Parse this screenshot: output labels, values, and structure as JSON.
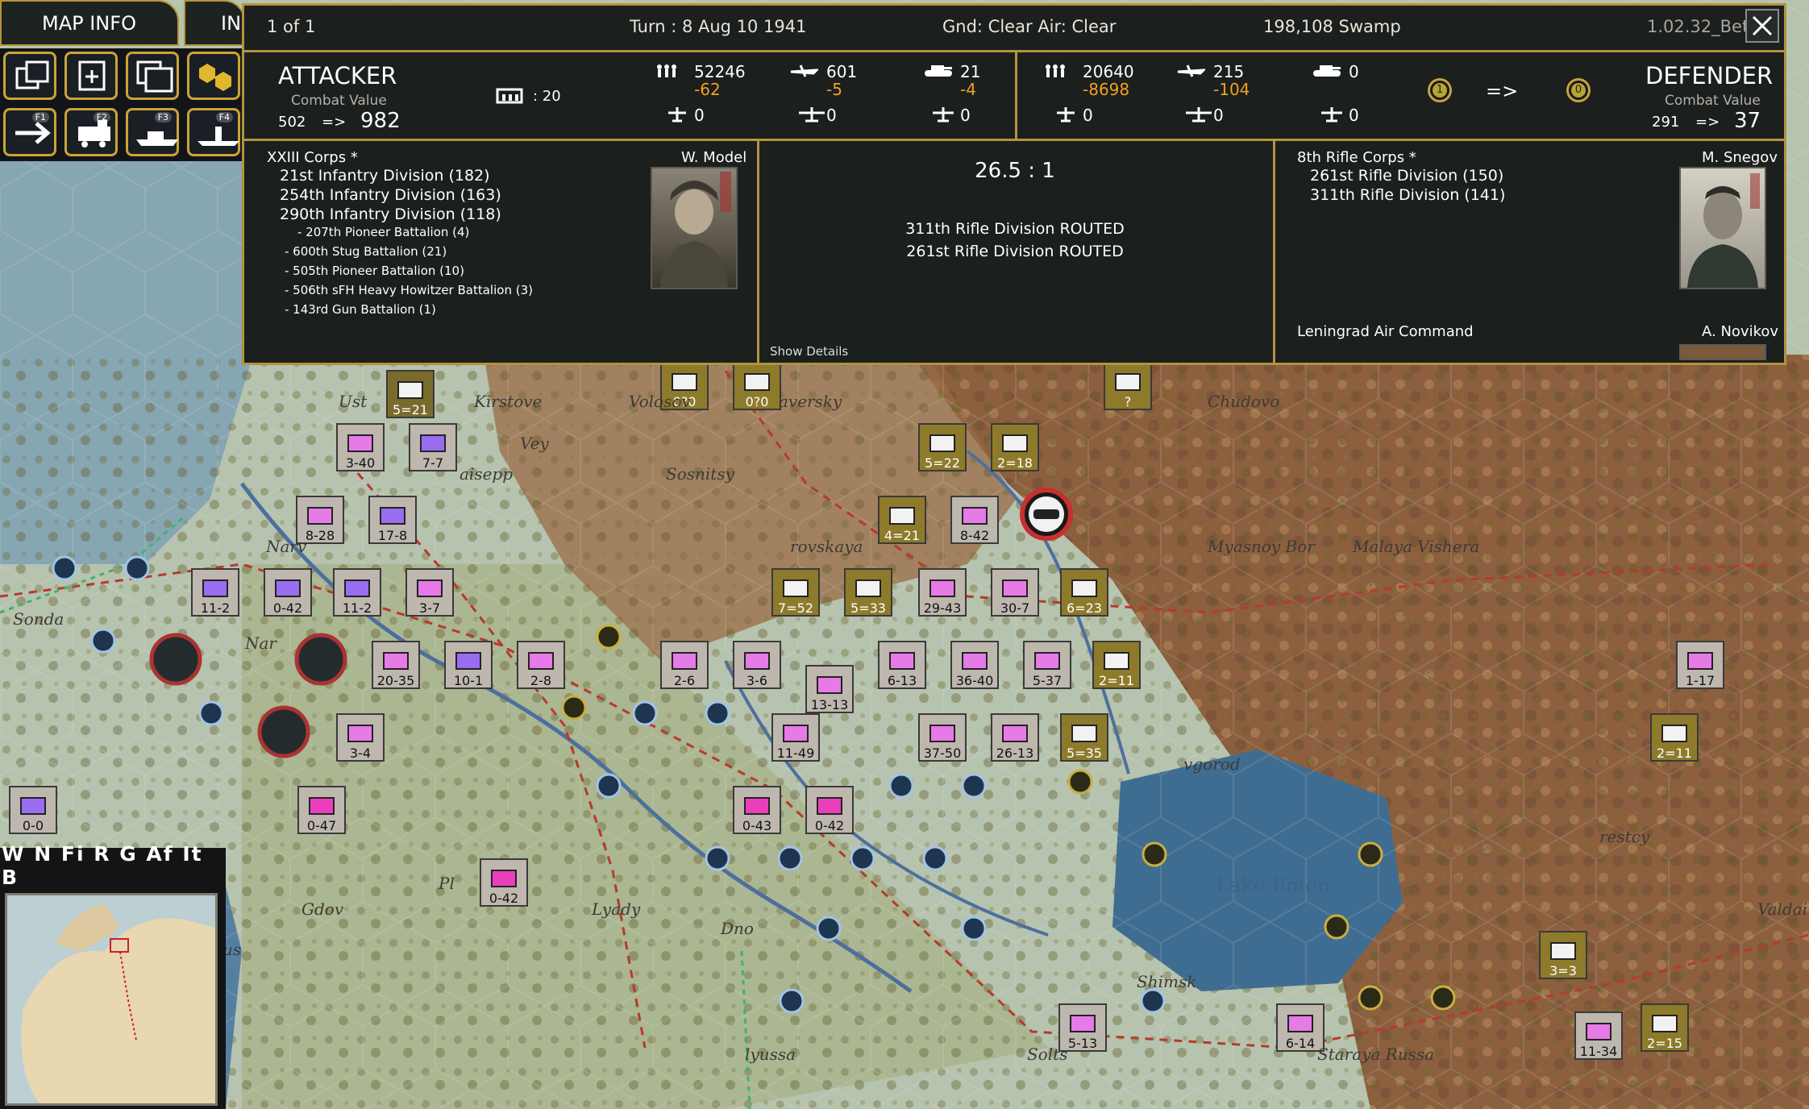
{
  "top_tabs": {
    "map_info": "MAP INFO",
    "second_tab": "IN"
  },
  "toolbar_row1": [
    {
      "icon": "copy-unit-icon"
    },
    {
      "icon": "add-unit-icon"
    },
    {
      "icon": "stacked-cards-icon"
    },
    {
      "icon": "hex-group-icon"
    }
  ],
  "toolbar_row2": [
    {
      "icon": "arrow-right-icon",
      "key": "F1"
    },
    {
      "icon": "train-icon",
      "key": "F2"
    },
    {
      "icon": "ship-icon",
      "key": "F3"
    },
    {
      "icon": "landing-ship-icon",
      "key": "F4"
    }
  ],
  "combat": {
    "counter": "1 of 1",
    "turn": "Turn : 8   Aug 10 1941",
    "weather": "Gnd: Clear  Air: Clear",
    "location": "198,108   Swamp",
    "version": "1.02.32_Beta",
    "attacker": {
      "title": "ATTACKER",
      "cv_label": "Combat Value",
      "cv_from": "502",
      "arrow": "=>",
      "cv_to": "982",
      "fort_value": ": 20",
      "men": "52246",
      "men_loss": "-62",
      "planes": "601",
      "planes_loss": "-5",
      "tanks": "21",
      "tanks_loss": "-4",
      "air1": "0",
      "air2": "0",
      "air3": "0"
    },
    "defender": {
      "title": "DEFENDER",
      "cv_label": "Combat Value",
      "cv_from": "291",
      "arrow": "=>",
      "cv_to": "37",
      "men": "20640",
      "men_loss": "-8698",
      "planes": "215",
      "planes_loss": "-104",
      "tanks": "0",
      "air1": "0",
      "air2": "0",
      "air3": "0",
      "fort_from": "1",
      "fort_arrow": "=>",
      "fort_to": "0"
    },
    "attacker_units": {
      "hq": "XXIII Corps *",
      "leader": "W. Model",
      "divisions": [
        "21st Infantry Division (182)",
        "254th Infantry Division (163)",
        "290th Infantry Division (118)"
      ],
      "support": [
        "- 207th Pioneer Battalion (4)",
        "- 600th Stug Battalion (21)",
        "- 505th Pioneer Battalion (10)",
        "- 506th sFH Heavy Howitzer Battalion (3)",
        "- 143rd Gun Battalion (1)"
      ]
    },
    "result": {
      "odds": "26.5 : 1",
      "lines": [
        "311th Rifle Division ROUTED",
        "261st Rifle Division ROUTED"
      ],
      "show_details": "Show Details"
    },
    "defender_units": {
      "hq": "8th Rifle Corps *",
      "leader": "M. Snegov",
      "divisions": [
        "261st Rifle Division (150)",
        "311th Rifle Division (141)"
      ],
      "air_command": "Leningrad Air Command",
      "air_leader": "A. Novikov"
    }
  },
  "map_labels": {
    "sonda": "Sonda",
    "ust": "Ust",
    "kirstove": "Kirstove",
    "volosov": "Volosov",
    "aversky": "aversky",
    "chudovo": "Chudovo",
    "vey": "Vey",
    "sosnitsy": "Sosnitsy",
    "aisepp": "aisepp",
    "narv": "Narv",
    "myasnoy_bor": "Myasnoy Bor",
    "malaya_vishera": "Malaya Vishera",
    "rovskaya": "rovskaya",
    "shimsk": "Shimsk",
    "lyady": "Lyady",
    "gdov": "Gdov",
    "lake_ilmen": "Lake Ilmen",
    "valdai": "Valdai",
    "novgorod": "vgorod",
    "krestcy": "restcy",
    "soltsy": "Solts",
    "staraya_russa": "Staraya Russa",
    "dno": "Dno",
    "us": "us",
    "kvyusa": "lyussa",
    "pl": "Pl",
    "nar": "Nar"
  },
  "units": [
    {
      "t": "5=21",
      "c": "inf"
    },
    {
      "t": "3-40",
      "c": "pink"
    },
    {
      "t": "7-7",
      "c": "purple"
    },
    {
      "t": "8-28",
      "c": "pink"
    },
    {
      "t": "17-8",
      "c": "purple"
    },
    {
      "t": "11-2",
      "c": "purple"
    },
    {
      "t": "0-42",
      "c": "purpleHQ"
    },
    {
      "t": "11-2",
      "c": "purple"
    },
    {
      "t": "3-7",
      "c": "pink"
    },
    {
      "t": "20-35",
      "c": "pink"
    },
    {
      "t": "10-1",
      "c": "purple"
    },
    {
      "t": "2-8",
      "c": "pink"
    },
    {
      "t": "2-6",
      "c": "pink"
    },
    {
      "t": "3-6",
      "c": "pink"
    },
    {
      "t": "13-13",
      "c": "pink"
    },
    {
      "t": "6-13",
      "c": "pink"
    },
    {
      "t": "36-40",
      "c": "pink"
    },
    {
      "t": "5-37",
      "c": "pink"
    },
    {
      "t": "2=11",
      "c": "sov"
    },
    {
      "t": "3-4",
      "c": "pink"
    },
    {
      "t": "11-49",
      "c": "pink"
    },
    {
      "t": "37-50",
      "c": "pink"
    },
    {
      "t": "26-13",
      "c": "pink"
    },
    {
      "t": "5=35",
      "c": "sov"
    },
    {
      "t": "0-47",
      "c": "pinkHQ"
    },
    {
      "t": "0-43",
      "c": "pinkHQ"
    },
    {
      "t": "0-42",
      "c": "pinkHQ"
    },
    {
      "t": "0-42",
      "c": "pinkHQ"
    },
    {
      "t": "0-0",
      "c": "purple"
    },
    {
      "t": "5-13",
      "c": "pink"
    },
    {
      "t": "6-14",
      "c": "pink"
    },
    {
      "t": "11-34",
      "c": "pink"
    },
    {
      "t": "2=15",
      "c": "sov"
    },
    {
      "t": "3=3",
      "c": "sov"
    },
    {
      "t": "1-17",
      "c": "pink"
    },
    {
      "t": "2=11",
      "c": "sovHQ"
    },
    {
      "t": "29-43",
      "c": "pink"
    },
    {
      "t": "30-7",
      "c": "pink"
    },
    {
      "t": "6=23",
      "c": "sov"
    },
    {
      "t": "7=52",
      "c": "sov"
    },
    {
      "t": "5=33",
      "c": "sov"
    },
    {
      "t": "4=21",
      "c": "sov"
    },
    {
      "t": "8-42",
      "c": "pink"
    },
    {
      "t": "5=22",
      "c": "sov"
    },
    {
      "t": "2=18",
      "c": "sov"
    },
    {
      "t": "0?0",
      "c": "sov"
    },
    {
      "t": "0?0",
      "c": "sovHQ"
    },
    {
      "t": "?",
      "c": "sov"
    }
  ],
  "minimap": {
    "tabs": "W N Fi R G Af It B"
  }
}
